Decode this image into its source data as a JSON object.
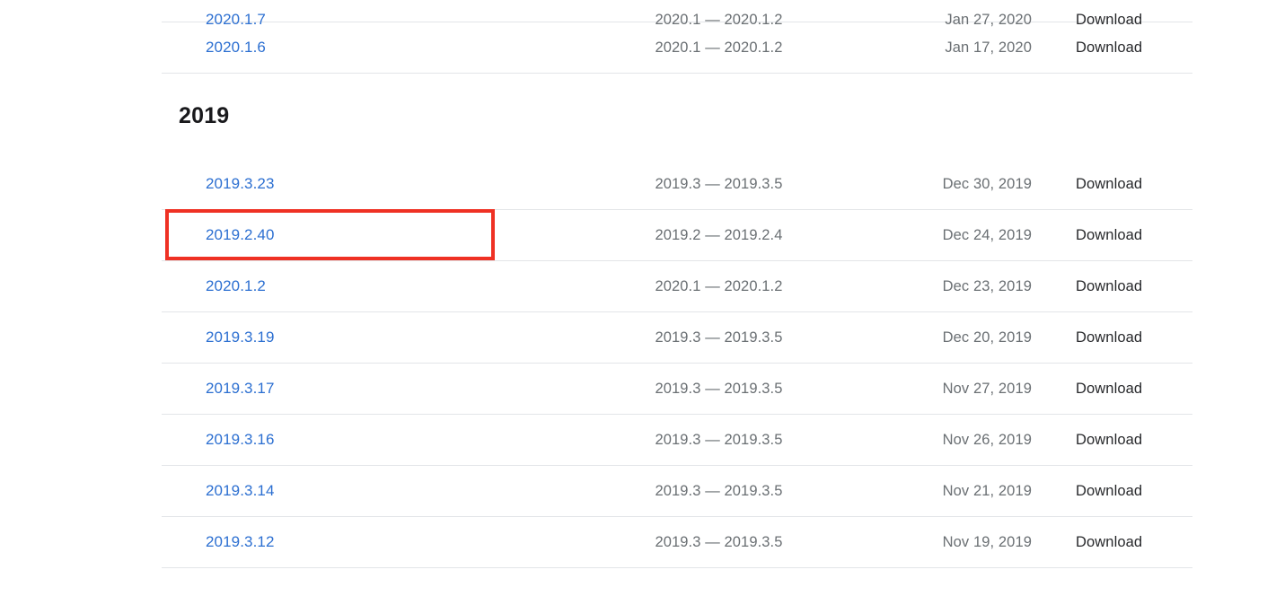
{
  "page": {
    "background_color": "#ffffff",
    "link_color": "#2c6fd1",
    "muted_text_color": "#6a6f73",
    "download_text_color": "#27282b",
    "row_border_color": "#e3e5e8",
    "annotation_color": "#ef3124"
  },
  "sections": [
    {
      "heading": null,
      "rows": [
        {
          "version": "2020.1.7",
          "range": "2020.1 — 2020.1.2",
          "date": "Jan 27, 2020",
          "download_label": "Download",
          "partial": true,
          "highlighted": false
        },
        {
          "version": "2020.1.6",
          "range": "2020.1 — 2020.1.2",
          "date": "Jan 17, 2020",
          "download_label": "Download",
          "partial": false,
          "highlighted": false
        }
      ]
    },
    {
      "heading": "2019",
      "rows": [
        {
          "version": "2019.3.23",
          "range": "2019.3 — 2019.3.5",
          "date": "Dec 30, 2019",
          "download_label": "Download",
          "partial": false,
          "highlighted": false
        },
        {
          "version": "2019.2.40",
          "range": "2019.2 — 2019.2.4",
          "date": "Dec 24, 2019",
          "download_label": "Download",
          "partial": false,
          "highlighted": true
        },
        {
          "version": "2020.1.2",
          "range": "2020.1 — 2020.1.2",
          "date": "Dec 23, 2019",
          "download_label": "Download",
          "partial": false,
          "highlighted": false
        },
        {
          "version": "2019.3.19",
          "range": "2019.3 — 2019.3.5",
          "date": "Dec 20, 2019",
          "download_label": "Download",
          "partial": false,
          "highlighted": false
        },
        {
          "version": "2019.3.17",
          "range": "2019.3 — 2019.3.5",
          "date": "Nov 27, 2019",
          "download_label": "Download",
          "partial": false,
          "highlighted": false
        },
        {
          "version": "2019.3.16",
          "range": "2019.3 — 2019.3.5",
          "date": "Nov 26, 2019",
          "download_label": "Download",
          "partial": false,
          "highlighted": false
        },
        {
          "version": "2019.3.14",
          "range": "2019.3 — 2019.3.5",
          "date": "Nov 21, 2019",
          "download_label": "Download",
          "partial": false,
          "highlighted": false
        },
        {
          "version": "2019.3.12",
          "range": "2019.3 — 2019.3.5",
          "date": "Nov 19, 2019",
          "download_label": "Download",
          "partial": false,
          "highlighted": false
        }
      ]
    }
  ]
}
